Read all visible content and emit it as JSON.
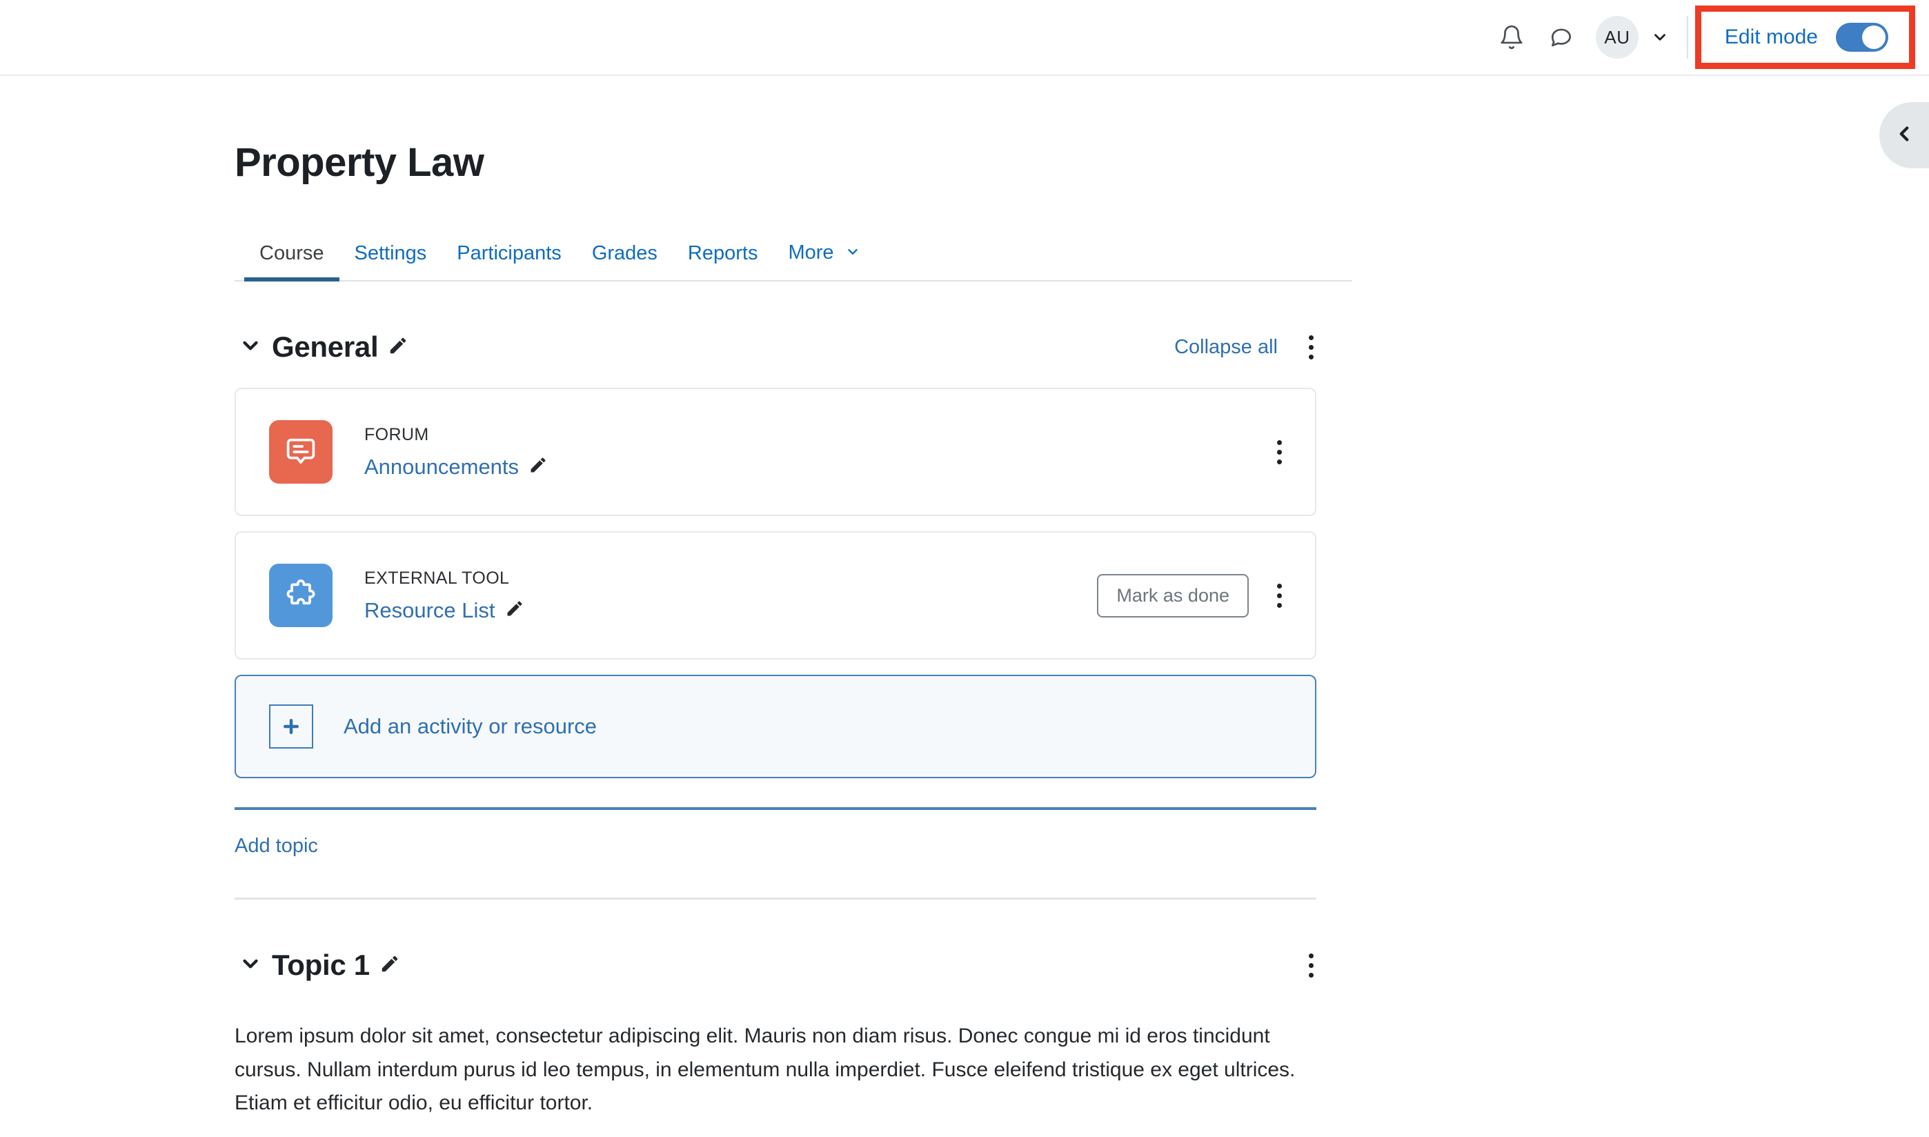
{
  "navbar": {
    "notifications_icon": "bell-icon",
    "messages_icon": "message-bubble-icon",
    "avatar_initials": "AU",
    "edit_mode": {
      "label": "Edit mode",
      "enabled": true,
      "accent_color": "#3d7ec4",
      "annotation_color": "#ee3b24"
    }
  },
  "drawer": {
    "toggle_icon": "chevron-left-icon"
  },
  "course": {
    "title": "Property Law",
    "tabs": [
      {
        "label": "Course",
        "active": true
      },
      {
        "label": "Settings",
        "active": false
      },
      {
        "label": "Participants",
        "active": false
      },
      {
        "label": "Grades",
        "active": false
      },
      {
        "label": "Reports",
        "active": false
      },
      {
        "label": "More",
        "active": false,
        "has_caret": true
      }
    ]
  },
  "general_section": {
    "title": "General",
    "collapse_all_label": "Collapse all",
    "edit_icon": "pencil-icon",
    "expanded": true,
    "activities": [
      {
        "type": "FORUM",
        "name": "Announcements",
        "icon": "forum-icon",
        "icon_color": "#e8674f",
        "completion_button": null
      },
      {
        "type": "EXTERNAL TOOL",
        "name": "Resource List",
        "icon": "puzzle-piece-icon",
        "icon_color": "#5397db",
        "completion_button": "Mark as done"
      }
    ],
    "add_activity_label": "Add an activity or resource"
  },
  "add_topic_label": "Add topic",
  "topic1": {
    "title": "Topic 1",
    "edit_icon": "pencil-icon",
    "expanded": true,
    "body": "Lorem ipsum dolor sit amet, consectetur adipiscing elit. Mauris non diam risus. Donec congue mi id eros tincidunt cursus. Nullam interdum purus id leo tempus, in elementum nulla imperdiet. Fusce eleifend tristique ex eget ultrices. Etiam et efficitur odio, eu efficitur tortor."
  }
}
